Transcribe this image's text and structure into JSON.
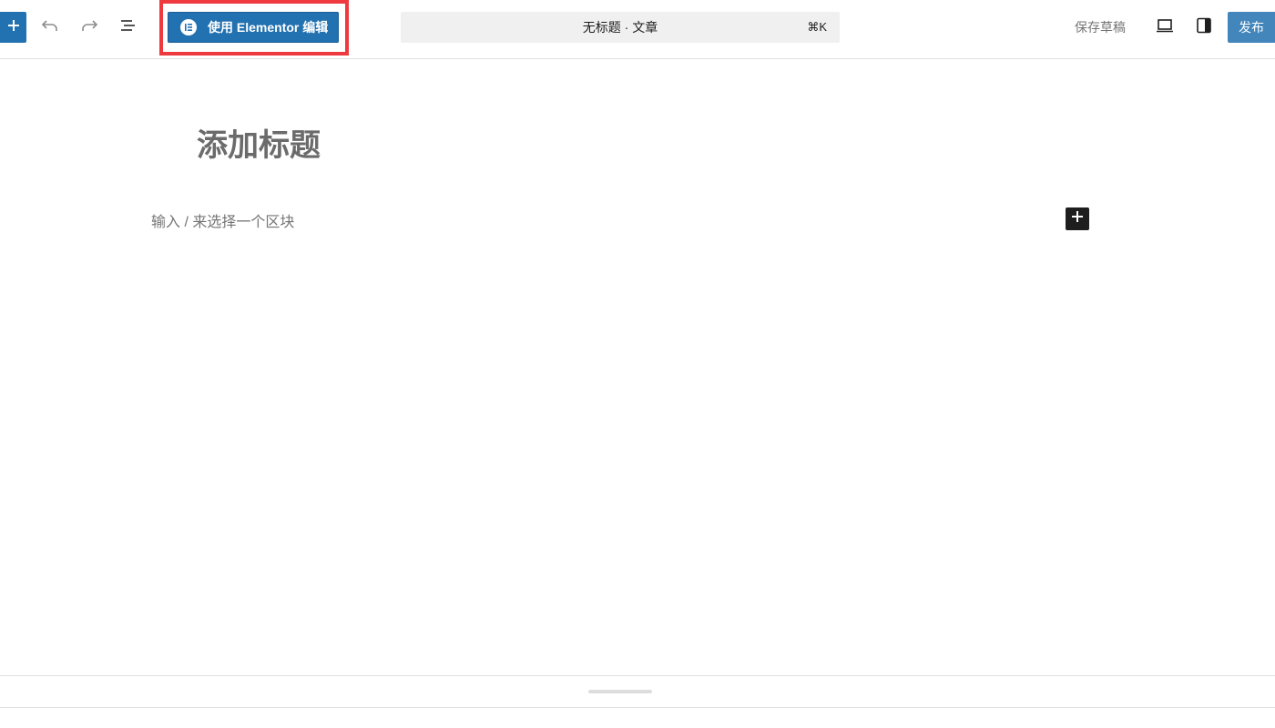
{
  "toolbar": {
    "inserter_icon": "plus-icon",
    "undo_icon": "undo-icon",
    "redo_icon": "redo-icon",
    "document_overview_icon": "list-view-icon",
    "elementor_button": {
      "label": "使用 Elementor 编辑",
      "icon": "elementor-logo-icon"
    },
    "highlight_color": "#ee3a3f",
    "accent_color": "#2271b1"
  },
  "command_bar": {
    "title": "无标题 · 文章",
    "shortcut": "⌘K"
  },
  "actions": {
    "save_draft": "保存草稿",
    "view_icon": "laptop-preview-icon",
    "settings_icon": "sidebar-settings-icon",
    "publish": "发布"
  },
  "editor": {
    "title_placeholder": "添加标题",
    "block_placeholder": "输入 / 来选择一个区块",
    "block_add_icon": "plus-icon"
  }
}
